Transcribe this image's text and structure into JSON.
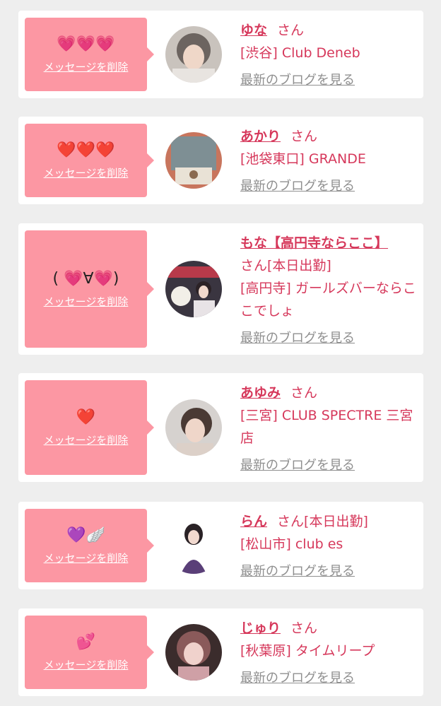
{
  "delete_label": "メッセージを削除",
  "blog_label": "最新のブログを見る",
  "honorific": "さん",
  "accent_color": "#d6385b",
  "bubble_color": "#fc97a3",
  "entries": [
    {
      "message": "💗💗💗",
      "name": "ゆな",
      "status": "",
      "shop": "[渋谷] Club Deneb"
    },
    {
      "message": "❤️❤️❤️",
      "name": "あかり",
      "status": "",
      "shop": "[池袋東口] GRANDE"
    },
    {
      "message": "( 💗∀💗)",
      "name": "もな【高円寺ならここ】",
      "status": "[本日出勤]",
      "shop": "[高円寺] ガールズバーならここでしょ"
    },
    {
      "message": "❤️",
      "name": "あゆみ",
      "status": "",
      "shop": "[三宮] CLUB SPECTRE 三宮店"
    },
    {
      "message": "💜🪽",
      "name": "らん",
      "status": "[本日出勤]",
      "shop": "[松山市] club es"
    },
    {
      "message": "💕",
      "name": "じゅり",
      "status": "",
      "shop": "[秋葉原] タイムリープ"
    }
  ]
}
